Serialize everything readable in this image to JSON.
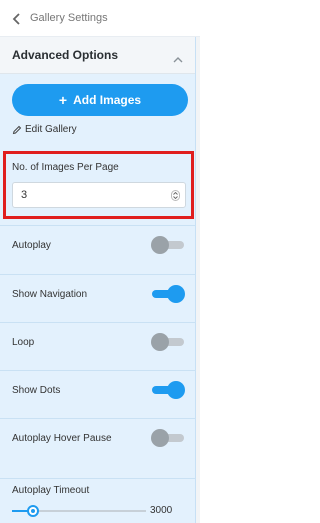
{
  "header": {
    "back_icon": "chevron-left",
    "title": "Gallery Settings"
  },
  "section": {
    "title": "Advanced Options",
    "collapse_icon": "chevron-up"
  },
  "actions": {
    "add_images_icon": "plus",
    "add_images_label": "Add Images",
    "edit_icon": "pencil",
    "edit_gallery_label": "Edit Gallery"
  },
  "images_per_page": {
    "label": "No. of Images Per Page",
    "value": "3",
    "highlight_color": "#e01e1e"
  },
  "settings": [
    {
      "label": "Autoplay",
      "enabled": false
    },
    {
      "label": "Show Navigation",
      "enabled": true
    },
    {
      "label": "Loop",
      "enabled": false
    },
    {
      "label": "Show Dots",
      "enabled": true
    },
    {
      "label": "Autoplay Hover Pause",
      "enabled": false
    }
  ],
  "timeout": {
    "label": "Autoplay Timeout",
    "value": "3000",
    "slider_fraction": 0.16
  },
  "colors": {
    "accent": "#1e9bf0",
    "panel_bg": "#e3f1fd"
  }
}
